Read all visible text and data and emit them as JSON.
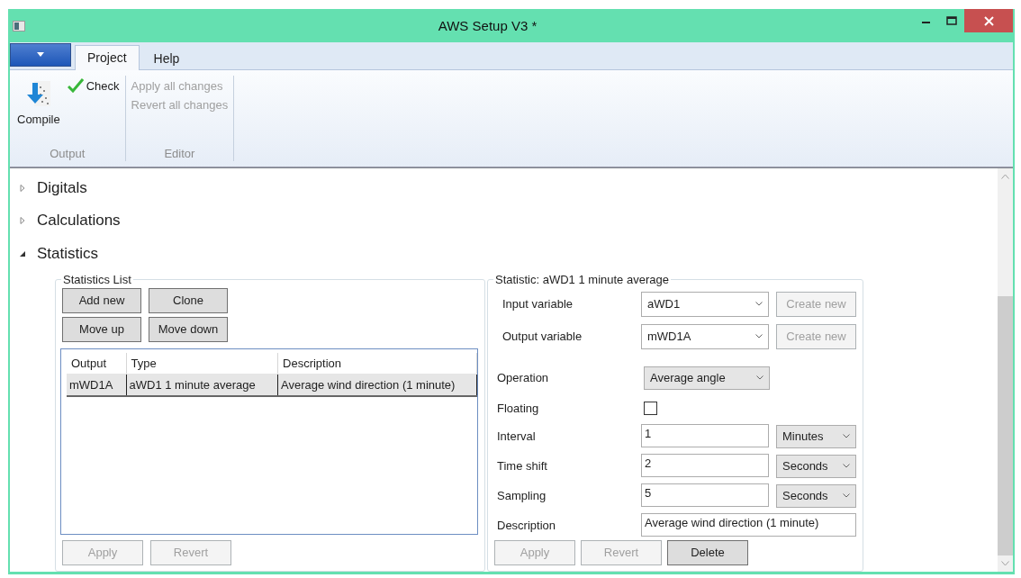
{
  "window": {
    "title": "AWS Setup V3 *"
  },
  "ribbon": {
    "tabs": [
      {
        "label": "Project",
        "selected": true
      },
      {
        "label": "Help",
        "selected": false
      }
    ],
    "groups": [
      {
        "label": "Output",
        "items": [
          {
            "kind": "large",
            "label": "Compile",
            "disabled": false
          },
          {
            "kind": "check",
            "label": "Check",
            "disabled": false
          }
        ]
      },
      {
        "label": "Editor",
        "items": [
          {
            "kind": "plain",
            "label": "Apply all changes",
            "disabled": true
          },
          {
            "kind": "plain",
            "label": "Revert all changes",
            "disabled": true
          }
        ]
      }
    ]
  },
  "sections": [
    {
      "title": "Digitals",
      "expanded": false
    },
    {
      "title": "Calculations",
      "expanded": false
    },
    {
      "title": "Statistics",
      "expanded": true
    }
  ],
  "statistics_list": {
    "title": "Statistics List",
    "buttons": [
      {
        "label": "Add new",
        "disabled": false
      },
      {
        "label": "Clone",
        "disabled": false
      },
      {
        "label": "Move up",
        "disabled": false
      },
      {
        "label": "Move down",
        "disabled": false
      }
    ],
    "table": {
      "columns": [
        "Output",
        "Type",
        "Description"
      ],
      "rows": [
        {
          "cells": [
            "mWD1A",
            "aWD1 1 minute average",
            "Average wind direction (1 minute)"
          ],
          "selected": true
        }
      ]
    },
    "footer_buttons": [
      {
        "label": "Apply",
        "disabled": true
      },
      {
        "label": "Revert",
        "disabled": true
      }
    ]
  },
  "statistic": {
    "title": "Statistic: aWD1 1 minute average",
    "fields": [
      {
        "kind": "combo",
        "label": "Input variable",
        "value": "aWD1",
        "button": "Create new",
        "button_disabled": true
      },
      {
        "kind": "combo",
        "label": "Output variable",
        "value": "mWD1A",
        "button": "Create new",
        "button_disabled": true
      },
      {
        "kind": "dropdown",
        "label": "Operation",
        "value": "Average angle"
      },
      {
        "kind": "checkbox",
        "label": "Floating",
        "checked": false
      },
      {
        "kind": "number_unit",
        "label": "Interval",
        "value": "1",
        "unit": "Minutes"
      },
      {
        "kind": "number_unit",
        "label": "Time shift",
        "value": "2",
        "unit": "Seconds"
      },
      {
        "kind": "number_unit",
        "label": "Sampling",
        "value": "5",
        "unit": "Seconds"
      },
      {
        "kind": "text",
        "label": "Description",
        "value": "Average wind direction (1 minute)"
      }
    ],
    "footer_buttons": [
      {
        "label": "Apply",
        "disabled": true
      },
      {
        "label": "Revert",
        "disabled": true
      },
      {
        "label": "Delete",
        "disabled": false
      }
    ]
  }
}
